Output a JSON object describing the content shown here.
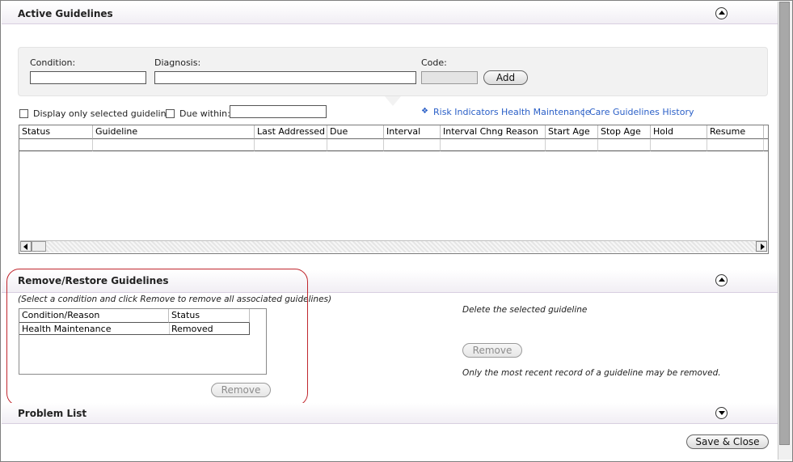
{
  "active_guidelines": {
    "title": "Active Guidelines",
    "form": {
      "condition_label": "Condition:",
      "condition_value": "",
      "diagnosis_label": "Diagnosis:",
      "diagnosis_value": "",
      "code_label": "Code:",
      "code_value": "",
      "add_label": "Add"
    },
    "display_only_label": "Display only selected guideline",
    "due_within_label": "Due within:",
    "due_within_value": "",
    "links": {
      "risk_indicators": "Risk Indicators",
      "health_maintenance": "Health Maintenance",
      "separator": "|",
      "care_guidelines_history": "Care Guidelines History"
    },
    "table": {
      "columns": [
        "Status",
        "Guideline",
        "Last Addressed",
        "Due",
        "Interval",
        "Interval Chng Reason",
        "Start Age",
        "Stop Age",
        "Hold",
        "Resume"
      ],
      "rows": []
    }
  },
  "remove_restore": {
    "title": "Remove/Restore Guidelines",
    "instruction": "(Select a condition and click Remove to remove all associated guidelines)",
    "table": {
      "columns": [
        "Condition/Reason",
        "Status"
      ],
      "rows": [
        [
          "Health Maintenance",
          "Removed"
        ]
      ]
    },
    "remove_label": "Remove",
    "delete_text": "Delete the selected  guideline",
    "remove2_label": "Remove",
    "note": "Only the most recent record of a guideline may be removed."
  },
  "problem_list": {
    "title": "Problem List"
  },
  "footer": {
    "save_close_label": "Save & Close"
  },
  "icons": {
    "collapse": "chevron-up-icon",
    "expand": "chevron-down-icon",
    "link_bullet": "diamond-bullet-icon"
  },
  "colors": {
    "link": "#2a5fc7",
    "highlight": "#c0262d"
  }
}
